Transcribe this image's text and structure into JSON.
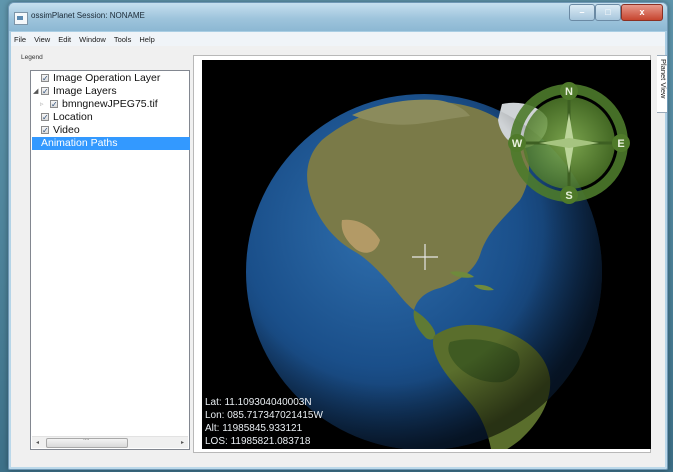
{
  "window": {
    "title": "ossimPlanet Session: NONAME",
    "controls": {
      "minimize": "–",
      "maximize": "□",
      "close": "x"
    }
  },
  "menu": [
    "File",
    "View",
    "Edit",
    "Window",
    "Tools",
    "Help"
  ],
  "legend": {
    "label": "Legend",
    "items": [
      {
        "label": "Image Operation Layer",
        "checked": true,
        "expander": ""
      },
      {
        "label": "Image Layers",
        "checked": true,
        "expander": "◢"
      },
      {
        "label": "bmngnewJPEG75.tif",
        "checked": true,
        "expander": "▹"
      },
      {
        "label": "Location",
        "checked": true,
        "expander": ""
      },
      {
        "label": "Video",
        "checked": true,
        "expander": ""
      },
      {
        "label": "Animation Paths",
        "checked": null,
        "expander": "",
        "selected": true
      }
    ],
    "scroll_left": "◂",
    "scroll_right": "▸"
  },
  "planet_view": {
    "tab_label": "Planet View",
    "compass": {
      "north": "N",
      "south": "S",
      "east": "E",
      "west": "W"
    },
    "readout": {
      "lat": "Lat: 11.109304040003N",
      "lon": "Lon: 085.717347021415W",
      "alt": "Alt: 11985845.933121",
      "los": "LOS: 11985821.083718"
    }
  },
  "colors": {
    "selection": "#3399ff",
    "ocean": "#1d4f8a",
    "land": "#6f7a3e",
    "compass": "#6f9a3c"
  }
}
